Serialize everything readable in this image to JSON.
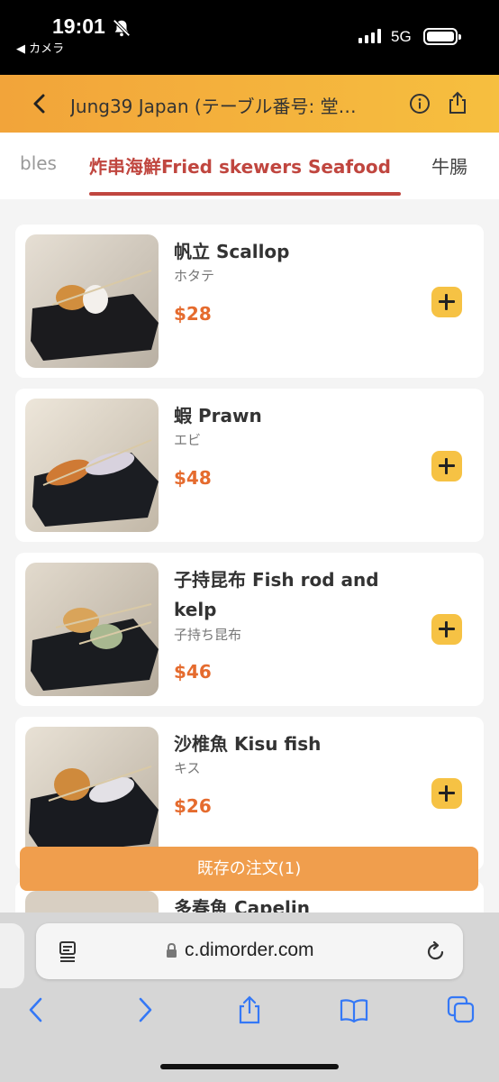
{
  "status_bar": {
    "time": "19:01",
    "back_app": "◀ カメラ",
    "network": "5G",
    "icons": [
      "bell-slash-icon",
      "signal-icon",
      "battery-icon"
    ]
  },
  "header": {
    "title": "Jung39 Japan (テーブル番号: 堂…",
    "icons": [
      "back-icon",
      "info-icon",
      "share-icon"
    ]
  },
  "tabs": {
    "prev": "bles",
    "active": "炸串海鮮Fried skewers Seafood",
    "next": "牛腸"
  },
  "items": [
    {
      "name": "帆立 Scallop",
      "jp": "ホタテ",
      "price": "$28"
    },
    {
      "name": "蝦 Prawn",
      "jp": "エビ",
      "price": "$48"
    },
    {
      "name": "子持昆布 Fish rod and kelp",
      "jp": "子持ち昆布",
      "price": "$46"
    },
    {
      "name": "沙椎魚 Kisu fish",
      "jp": "キス",
      "price": "$26"
    },
    {
      "name": "多春魚 Capelin"
    }
  ],
  "order_bar": {
    "label": "既存の注文(1)"
  },
  "browser": {
    "url": "c.dimorder.com",
    "icons": [
      "reader-icon",
      "lock-icon",
      "reload-icon",
      "back-arrow-icon",
      "forward-arrow-icon",
      "share-icon",
      "bookmarks-icon",
      "tabs-icon"
    ]
  },
  "colors": {
    "header_start": "#f2a43a",
    "header_end": "#f6bf3f",
    "accent_red": "#c0463f",
    "price": "#e56b2e",
    "add_button": "#f6c244",
    "order_bar": "#f09e4d",
    "browser_blue": "#3478f6"
  }
}
